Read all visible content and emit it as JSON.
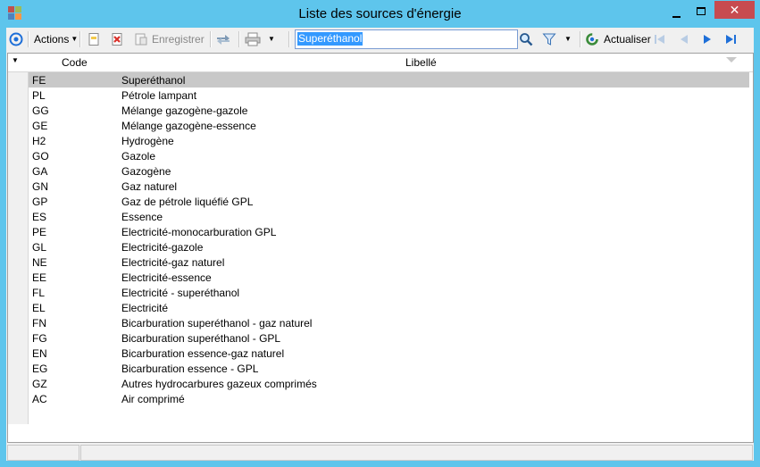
{
  "window": {
    "title": "Liste des sources d'énergie"
  },
  "toolbar": {
    "actions_label": "Actions",
    "save_label": "Enregistrer",
    "search_value": "Superéthanol",
    "refresh_label": "Actualiser"
  },
  "grid": {
    "columns": [
      "Code",
      "Libellé"
    ],
    "rows": [
      {
        "code": "FE",
        "libelle": "Superéthanol"
      },
      {
        "code": "PL",
        "libelle": "Pétrole lampant"
      },
      {
        "code": "GG",
        "libelle": "Mélange gazogène-gazole"
      },
      {
        "code": "GE",
        "libelle": "Mélange gazogène-essence"
      },
      {
        "code": "H2",
        "libelle": "Hydrogène"
      },
      {
        "code": "GO",
        "libelle": "Gazole"
      },
      {
        "code": "GA",
        "libelle": "Gazogène"
      },
      {
        "code": "GN",
        "libelle": "Gaz naturel"
      },
      {
        "code": "GP",
        "libelle": "Gaz de pétrole liquéfié GPL"
      },
      {
        "code": "ES",
        "libelle": "Essence"
      },
      {
        "code": "PE",
        "libelle": "Electricité-monocarburation GPL"
      },
      {
        "code": "GL",
        "libelle": "Electricité-gazole"
      },
      {
        "code": "NE",
        "libelle": "Electricité-gaz naturel"
      },
      {
        "code": "EE",
        "libelle": "Electricité-essence"
      },
      {
        "code": "FL",
        "libelle": "Electricité - superéthanol"
      },
      {
        "code": "EL",
        "libelle": "Electricité"
      },
      {
        "code": "FN",
        "libelle": "Bicarburation superéthanol - gaz naturel"
      },
      {
        "code": "FG",
        "libelle": "Bicarburation superéthanol - GPL"
      },
      {
        "code": "EN",
        "libelle": "Bicarburation essence-gaz naturel"
      },
      {
        "code": "EG",
        "libelle": "Bicarburation essence - GPL"
      },
      {
        "code": "GZ",
        "libelle": "Autres hydrocarbures gazeux comprimés"
      },
      {
        "code": "AC",
        "libelle": "Air comprimé"
      }
    ]
  },
  "colors": {
    "titlebar": "#5ec5ec",
    "selection": "#c8c8c8",
    "accent": "#1e6fd8"
  }
}
